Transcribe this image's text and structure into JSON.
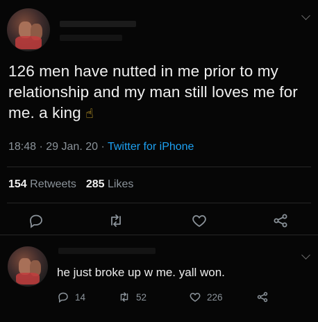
{
  "tweet": {
    "text": "126 men have nutted in me prior to my relationship and my man still loves me for me. a king",
    "emoji_icon": "pointing-up-hand-icon",
    "time": "18:48",
    "sep1": "·",
    "date": "29 Jan. 20",
    "sep2": "·",
    "client": "Twitter for iPhone",
    "retweets_count": "154",
    "retweets_label": "Retweets",
    "likes_count": "285",
    "likes_label": "Likes"
  },
  "reply": {
    "text": "he just broke up w me. yall won.",
    "replies": "14",
    "retweets": "52",
    "likes": "226"
  },
  "colors": {
    "background": "#060606",
    "text": "#f0f0f0",
    "muted": "#8b939a",
    "link": "#1da1f2"
  }
}
